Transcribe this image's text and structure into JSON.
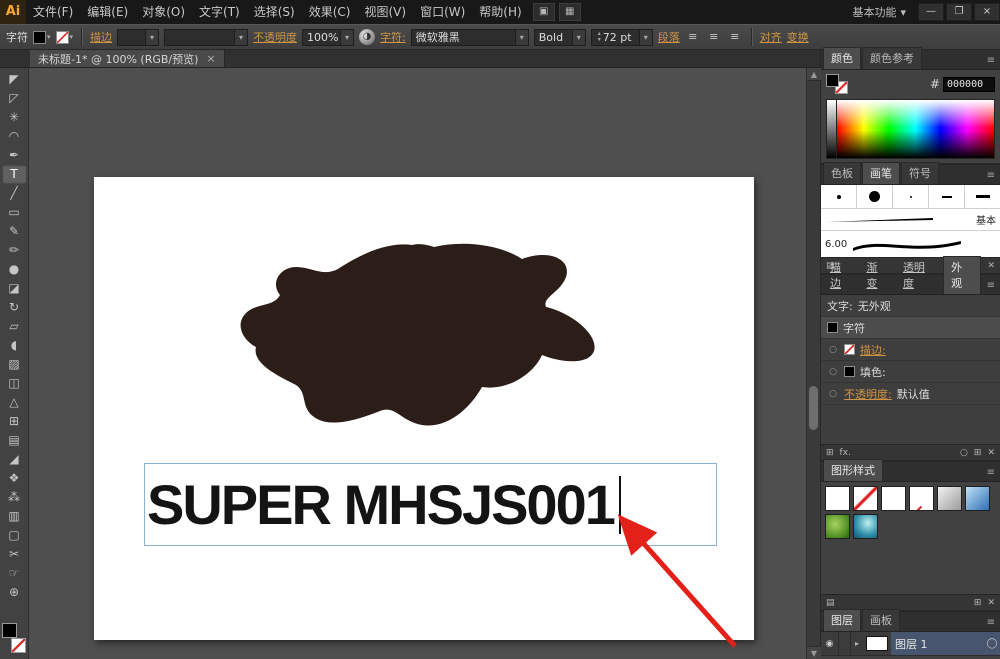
{
  "colors": {
    "link_orange": "#cf9545",
    "annotation_red": "#e32119",
    "blob_fill": "#2b1d17",
    "canvas_text_color": "#141414",
    "text_frame_blue": "#8ab0d5",
    "hex_swatch": "#000000"
  },
  "titlebar": {
    "logo_text": "Ai",
    "menus": [
      "文件(F)",
      "编辑(E)",
      "对象(O)",
      "文字(T)",
      "选择(S)",
      "效果(C)",
      "视图(V)",
      "窗口(W)",
      "帮助(H)"
    ],
    "doc_icon": "▣",
    "arrange_icon": "▦",
    "workspace_switcher": "基本功能",
    "workspace_chevron": "▾",
    "minimize_icon": "—",
    "restore_icon": "❐",
    "close_icon": "×"
  },
  "control_bar": {
    "context_label": "字符",
    "chevron": "▾",
    "stroke_link": "描边",
    "opacity_link": "不透明度",
    "opacity_value": "100%",
    "recolor_icon": "◑",
    "character_link": "字符:",
    "font_family": "微软雅黑",
    "font_style": "Bold",
    "font_size": "72 pt",
    "spinner_up": "▴",
    "spinner_down": "▾",
    "paragraph_link": "段落",
    "align_left_icon": "≡",
    "align_center_icon": "≡",
    "align_right_icon": "≡",
    "align_link": "对齐",
    "transform_link": "变换"
  },
  "document_tab": {
    "title": "未标题-1* @ 100% (RGB/预览)",
    "close_icon": "×"
  },
  "tools": [
    {
      "name": "selection",
      "glyph": "◤"
    },
    {
      "name": "direct-selection",
      "glyph": "◸"
    },
    {
      "name": "magic-wand",
      "glyph": "✳"
    },
    {
      "name": "lasso",
      "glyph": "◠"
    },
    {
      "name": "pen",
      "glyph": "✒"
    },
    {
      "name": "type",
      "glyph": "T"
    },
    {
      "name": "line-segment",
      "glyph": "╱"
    },
    {
      "name": "rectangle",
      "glyph": "▭"
    },
    {
      "name": "paintbrush",
      "glyph": "✎"
    },
    {
      "name": "pencil",
      "glyph": "✏"
    },
    {
      "name": "blob-brush",
      "glyph": "●"
    },
    {
      "name": "eraser",
      "glyph": "◪"
    },
    {
      "name": "rotate",
      "glyph": "↻"
    },
    {
      "name": "scale",
      "glyph": "▱"
    },
    {
      "name": "width",
      "glyph": "◖"
    },
    {
      "name": "free-transform",
      "glyph": "▨"
    },
    {
      "name": "shape-builder",
      "glyph": "◫"
    },
    {
      "name": "perspective-grid",
      "glyph": "△"
    },
    {
      "name": "mesh",
      "glyph": "⊞"
    },
    {
      "name": "gradient",
      "glyph": "▤"
    },
    {
      "name": "eyedropper",
      "glyph": "◢"
    },
    {
      "name": "blend",
      "glyph": "❖"
    },
    {
      "name": "symbol-sprayer",
      "glyph": "⁂"
    },
    {
      "name": "column-graph",
      "glyph": "▥"
    },
    {
      "name": "artboard",
      "glyph": "▢"
    },
    {
      "name": "slice",
      "glyph": "✂"
    },
    {
      "name": "hand",
      "glyph": "☞"
    },
    {
      "name": "zoom",
      "glyph": "⊕"
    }
  ],
  "canvas": {
    "text_content": "SUPER MHSJS001"
  },
  "scrollbar": {
    "up_icon": "▲",
    "down_icon": "▼"
  },
  "panels": {
    "panel_menu_icon": "≡",
    "color": {
      "tab_color": "颜色",
      "tab_color_guide": "颜色参考",
      "hex_label": "#",
      "hex_value": "000000"
    },
    "brushes": {
      "tab_swatches": "色板",
      "tab_brushes": "画笔",
      "tab_symbols": "符号",
      "basic_label": "基本",
      "size_label": "6.00",
      "libraries_icon": "▤",
      "new_icon": "⊞",
      "delete_icon": "✕"
    },
    "appearance": {
      "tab_stroke": "描边",
      "tab_gradient": "渐变",
      "tab_transparency": "透明度",
      "tab_appearance": "外观",
      "type_label": "文字:",
      "type_value": "无外观",
      "characters_label": "字符",
      "stroke_label": "描边:",
      "fill_label": "填色:",
      "opacity_label": "不透明度:",
      "opacity_value": "默认值",
      "visibility_icon": "○",
      "fx_label": "fx.",
      "new_icon": "⊞",
      "clear_icon": "○",
      "delete_icon": "✕"
    },
    "graphic_styles": {
      "tab": "图形样式",
      "libraries_icon": "▤",
      "new_icon": "⊞",
      "delete_icon": "✕"
    },
    "layers": {
      "tab_layers": "图层",
      "tab_artboards": "画板",
      "eye_icon": "◉",
      "expand_icon": "▸",
      "layer_name": "图层 1",
      "target_icon": "◯"
    }
  }
}
